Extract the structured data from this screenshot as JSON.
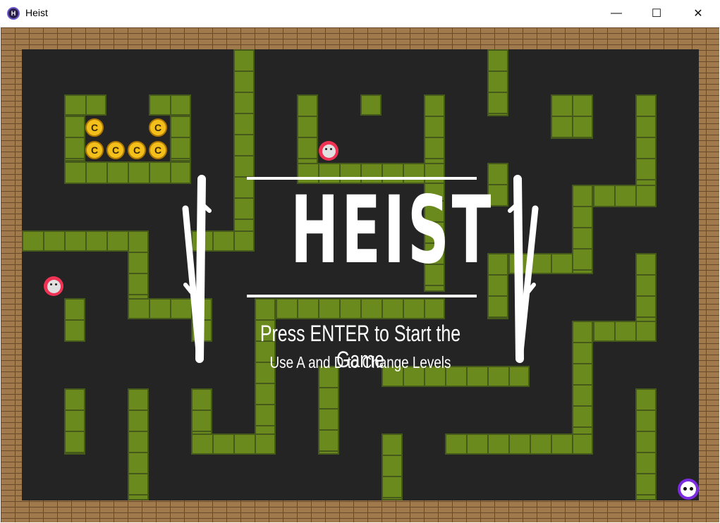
{
  "window": {
    "title": "Heist",
    "icon_letter": "H",
    "controls": {
      "minimize": "—",
      "maximize": "☐",
      "close": "✕"
    }
  },
  "title_screen": {
    "logo": "HEIST",
    "start_prompt": "Press ENTER to Start the Game",
    "level_prompt": "Use A and D to Change Levels"
  },
  "coins": {
    "label": "C",
    "count": 6
  },
  "guards": {
    "count": 2
  },
  "colors": {
    "wall": "#6b8a1e",
    "floor": "#242424",
    "brick": "#a0794c",
    "coin": "#f3bf1b",
    "guard": "#ee3355",
    "player": "#7b2be0"
  }
}
